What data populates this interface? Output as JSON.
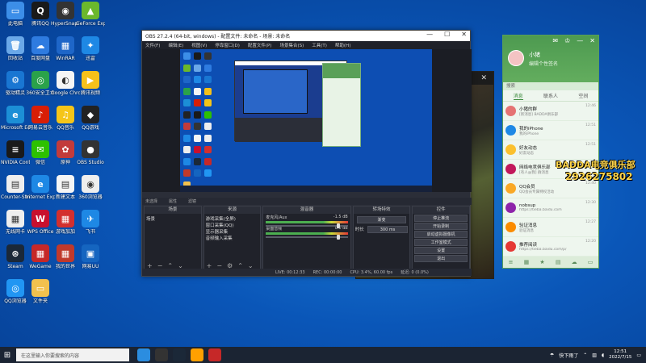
{
  "desktop": {
    "icons": [
      {
        "label": "此电脑",
        "color": "#3c8ee8",
        "glyph": "▭"
      },
      {
        "label": "腾讯QQ",
        "color": "#1a1a1a",
        "glyph": "Q"
      },
      {
        "label": "HyperSnap 7",
        "color": "#333",
        "glyph": "◉"
      },
      {
        "label": "GeForce Experience",
        "color": "#6bb82c",
        "glyph": "▲"
      },
      {
        "label": "回收站",
        "color": "#6aa8e8",
        "glyph": "🗑"
      },
      {
        "label": "百度网盘",
        "color": "#2e7be0",
        "glyph": "☁"
      },
      {
        "label": "WinRAR",
        "color": "#1e66c8",
        "glyph": "▦"
      },
      {
        "label": "迅雷",
        "color": "#1e88e5",
        "glyph": "✦"
      },
      {
        "label": "驱动精灵",
        "color": "#1976d2",
        "glyph": "⚙"
      },
      {
        "label": "360安全卫士",
        "color": "#2aa24a",
        "glyph": "◎"
      },
      {
        "label": "Google Chrome",
        "color": "#f5f5f5",
        "glyph": "◐"
      },
      {
        "label": "腾讯视频",
        "color": "#f5c11a",
        "glyph": "▶"
      },
      {
        "label": "Microsoft Edge",
        "color": "#1c8fd6",
        "glyph": "e"
      },
      {
        "label": "网易云音乐",
        "color": "#d81e06",
        "glyph": "♪"
      },
      {
        "label": "QQ音乐",
        "color": "#f5c518",
        "glyph": "♫"
      },
      {
        "label": "QQ游戏",
        "color": "#222",
        "glyph": "◆"
      },
      {
        "label": "NVIDIA Control",
        "color": "#1a1a1a",
        "glyph": "≡"
      },
      {
        "label": "微信",
        "color": "#2dc100",
        "glyph": "✉"
      },
      {
        "label": "原神",
        "color": "#c23b3b",
        "glyph": "✿"
      },
      {
        "label": "OBS Studio",
        "color": "#333",
        "glyph": "●"
      },
      {
        "label": "Counter-Strike",
        "color": "#eee",
        "glyph": "▤"
      },
      {
        "label": "Internet Explorer",
        "color": "#1e88e5",
        "glyph": "e"
      },
      {
        "label": "新建文本",
        "color": "#f5f5f5",
        "glyph": "▤"
      },
      {
        "label": "360浏览器",
        "color": "#eee",
        "glyph": "◉"
      },
      {
        "label": "无线网卡",
        "color": "#eee",
        "glyph": "▦"
      },
      {
        "label": "WPS Office",
        "color": "#c8102e",
        "glyph": "W"
      },
      {
        "label": "游戏加加",
        "color": "#d32f2f",
        "glyph": "▦"
      },
      {
        "label": "飞书",
        "color": "#1e88e5",
        "glyph": "✈"
      },
      {
        "label": "Steam",
        "color": "#1b2838",
        "glyph": "⊛"
      },
      {
        "label": "WeGame",
        "color": "#c62828",
        "glyph": "▦"
      },
      {
        "label": "我的世界",
        "color": "#c0392b",
        "glyph": "▦"
      },
      {
        "label": "网易UU",
        "color": "#1565c0",
        "glyph": "▣"
      },
      {
        "label": "QQ浏览器",
        "color": "#2196f3",
        "glyph": "◎"
      },
      {
        "label": "文件夹",
        "color": "#f2c14e",
        "glyph": "▭"
      }
    ]
  },
  "obs": {
    "title": "OBS 27.2.4 (64-bit, windows) - 配置文件: 未命名 - 场景: 未命名",
    "menu": [
      "文件(F)",
      "编辑(E)",
      "视图(V)",
      "停靠窗口(D)",
      "配置文件(P)",
      "场景集合(S)",
      "工具(T)",
      "帮助(H)"
    ],
    "status_line": "未选择",
    "status_props": "属性",
    "status_filters": "滤镜",
    "scenes_title": "场景",
    "scene_item": "场景",
    "sources_title": "来源",
    "sources": [
      "游戏采集(全屏)",
      "窗口采集(QQ)",
      "显示器采集",
      "音频输入采集"
    ],
    "mixer_title": "混音器",
    "mixer_tracks": [
      {
        "name": "麦克风/Aux",
        "db": "-1.5 dB"
      },
      {
        "name": "桌面音频",
        "db": "0.0 dB"
      }
    ],
    "transitions_title": "转场特效",
    "transition_type": "渐变",
    "transition_duration_label": "时长",
    "transition_duration": "300 ms",
    "controls_title": "控件",
    "controls": [
      "停止推流",
      "开始录制",
      "启动虚拟摄像机",
      "工作室模式",
      "设置",
      "退出"
    ],
    "statusbar": {
      "live": "LIVE: 00:12:33",
      "rec": "REC: 00:00:00",
      "cpu": "CPU: 3.4%, 60.00 fps",
      "delay": "延迟: 0 (0.0%)"
    }
  },
  "qq": {
    "nickname": "小猪",
    "signature": "编辑个性签名",
    "search_placeholder": "搜索",
    "tabs": [
      "消息",
      "联系人",
      "空间"
    ],
    "items": [
      {
        "name": "小猪的群",
        "msg": "[新消息] BADDA俱乐部",
        "time": "12:46",
        "color": "#e57373"
      },
      {
        "name": "我的iPhone",
        "msg": "我的iPhone",
        "time": "12:51",
        "color": "#1e88e5"
      },
      {
        "name": "好友动态",
        "msg": "好友动态",
        "time": "12:51",
        "color": "#fbc02d"
      },
      {
        "name": "网络电竞俱乐部",
        "msg": "[有人@我] 群消息",
        "time": "12:44",
        "color": "#c2185b"
      },
      {
        "name": "QQ会员",
        "msg": "QQ会员专属特权活动",
        "time": "12:40",
        "color": "#f9a825"
      },
      {
        "name": "nobsup",
        "msg": "https://tieba.baidu.com",
        "time": "12:30",
        "color": "#8e24aa"
      },
      {
        "name": "验证消息",
        "msg": "验证消息",
        "time": "12:27",
        "color": "#fb8c00"
      },
      {
        "name": "推荐阅读",
        "msg": "https://tieba.baidu.com/p/",
        "time": "12:20",
        "color": "#e53935"
      }
    ]
  },
  "overlay": {
    "line1": "BADDA电竞俱乐部",
    "line2": "2926275802"
  },
  "taskbar": {
    "search_placeholder": "在这里输入你要搜索的内容",
    "weather": "快下雨了",
    "time": "12:51",
    "date": "2022/7/15"
  }
}
